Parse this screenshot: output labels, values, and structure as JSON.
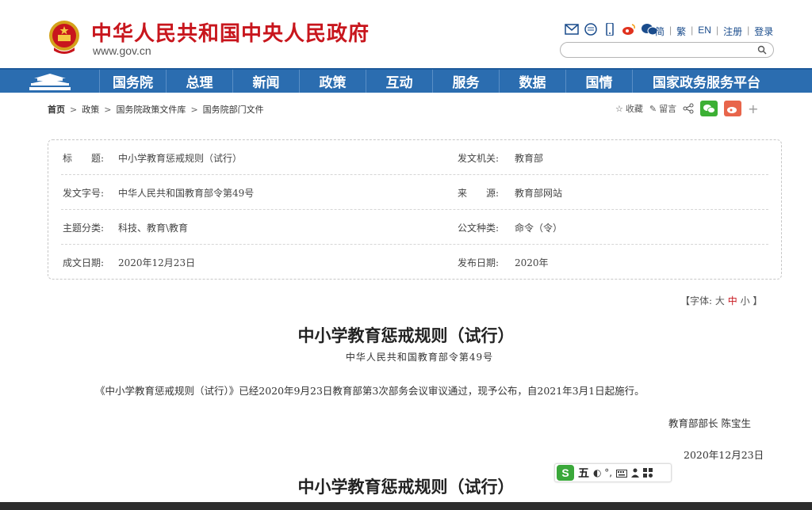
{
  "header": {
    "site_title": "中华人民共和国中央人民政府",
    "site_url": "www.gov.cn",
    "icons": [
      "mail-icon",
      "message-icon",
      "mobile-icon",
      "weibo-icon",
      "wechat-icon"
    ],
    "lang_links": [
      "简",
      "繁",
      "EN",
      "注册",
      "登录"
    ],
    "search_placeholder": ""
  },
  "nav": {
    "items": [
      "国务院",
      "总理",
      "新闻",
      "政策",
      "互动",
      "服务",
      "数据",
      "国情",
      "国家政务服务平台"
    ]
  },
  "breadcrumb": {
    "home": "首页",
    "items": [
      "政策",
      "国务院政策文件库",
      "国务院部门文件"
    ]
  },
  "share": {
    "favorite": "收藏",
    "comment": "留言"
  },
  "info": {
    "title_label": "标　　题:",
    "title_value": "中小学教育惩戒规则（试行）",
    "issuer_label": "发文机关:",
    "issuer_value": "教育部",
    "docno_label": "发文字号:",
    "docno_value": "中华人民共和国教育部令第49号",
    "source_label": "来　　源:",
    "source_value": "教育部网站",
    "topic_label": "主题分类:",
    "topic_value": "科技、教育\\教育",
    "genre_label": "公文种类:",
    "genre_value": "命令（令）",
    "written_label": "成文日期:",
    "written_value": "2020年12月23日",
    "published_label": "发布日期:",
    "published_value": "2020年"
  },
  "font_size": {
    "prefix": "【字体:",
    "large": "大",
    "medium": "中",
    "small": "小",
    "suffix": "】"
  },
  "document": {
    "title": "中小学教育惩戒规则（试行）",
    "subtitle": "中华人民共和国教育部令第49号",
    "paragraph": "《中小学教育惩戒规则（试行）》已经2020年9月23日教育部第3次部务会议审议通过，现予公布，自2021年3月1日起施行。",
    "signature": "教育部部长  陈宝生",
    "date": "2020年12月23日",
    "title2": "中小学教育惩戒规则（试行）"
  },
  "ime": {
    "logo": "S",
    "mode": "五",
    "symbols": "◐ °,"
  },
  "colors": {
    "brand_red": "#c8161d",
    "nav_blue": "#2b6db0",
    "wechat_green": "#3cb034",
    "weibo_orange": "#e8654b"
  }
}
